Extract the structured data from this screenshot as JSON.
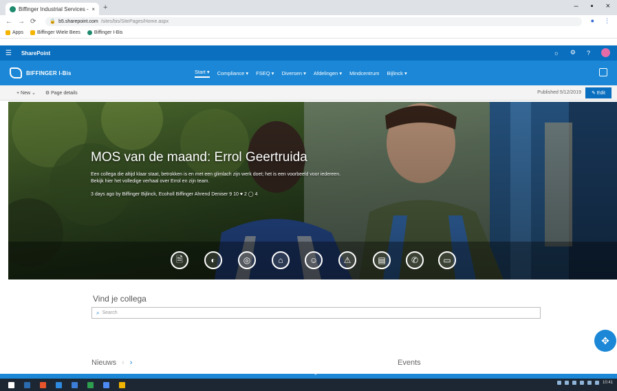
{
  "browser": {
    "tab_title": "Biffinger Industrial Services - Ho",
    "new_tab": "+",
    "window_controls": [
      "–",
      "▪",
      "×"
    ],
    "nav": {
      "back": "←",
      "forward": "→",
      "reload": "⟳"
    },
    "url_host": "b5.sharepoint.com",
    "url_path": "/sites/bis/SitePages/Home.aspx",
    "extensions": [
      "●",
      "⋮"
    ],
    "bookmarks": [
      {
        "label": "Apps",
        "icon": "apps-grid-icon"
      },
      {
        "label": "Biffinger Wiele Bees",
        "icon": "bookmark-icon"
      },
      {
        "label": "Biffinger I-Bis",
        "icon": "bookmark-icon"
      }
    ]
  },
  "suite": {
    "waffle": "☰",
    "app_name": "SharePoint",
    "icons": [
      "☼",
      "⚙",
      "?"
    ]
  },
  "site": {
    "name": "BIFFINGER I-Bis",
    "nav": [
      "Start ▾",
      "Compliance ▾",
      "FSEQ ▾",
      "Diversen ▾",
      "Afdelingen ▾",
      "Mindcentrum",
      "Bijlinck ▾"
    ]
  },
  "command_bar": {
    "new": "+ New ⌄",
    "page_details": "⚙ Page details",
    "published": "Published 5/12/2019",
    "edit": "✎ Edit"
  },
  "hero": {
    "title": "MOS van de maand: Errol Geertruida",
    "description": "Een collega die altijd klaar staat, betrokken is en met een glimlach zijn werk doet; het is een voorbeeld voor iedereen. Bekijk hier het volledige verhaal over Errol en zijn team.",
    "meta": "3 days ago by Biffinger Bijlinck, Ecoholl Biffinger Ahrend Deniser   9 10   ♥ 2   ◯ 4"
  },
  "quick_links": [
    {
      "glyph": "🗎",
      "icon": "document-icon"
    },
    {
      "glyph": "◐",
      "icon": "pie-chart-icon"
    },
    {
      "glyph": "◎",
      "icon": "globe-icon"
    },
    {
      "glyph": "⌂",
      "icon": "home-icon"
    },
    {
      "glyph": "☺",
      "icon": "people-icon"
    },
    {
      "glyph": "⚠",
      "icon": "warning-icon"
    },
    {
      "glyph": "▤",
      "icon": "book-icon"
    },
    {
      "glyph": "✆",
      "icon": "phone-icon"
    },
    {
      "glyph": "▭",
      "icon": "laptop-icon"
    }
  ],
  "people_search": {
    "label": "Vind je collega",
    "placeholder": "Search"
  },
  "news": {
    "label": "Nieuws",
    "prev": "‹",
    "next": "›"
  },
  "events": {
    "label": "Events"
  },
  "fab_glyph": "✥",
  "footer_chevron": "⌃",
  "taskbar": {
    "items": [
      "#2b6cb0",
      "#e8542b",
      "#2d8ae0",
      "#3b7dd8",
      "#2e9e4f",
      "#4c8bf5",
      "#f0b400",
      "#f5c518"
    ],
    "clock": "10:41"
  },
  "colors": {
    "suite_bar": "#0a6fbf",
    "site_header": "#1b87d6",
    "accent": "#1b87d6"
  }
}
